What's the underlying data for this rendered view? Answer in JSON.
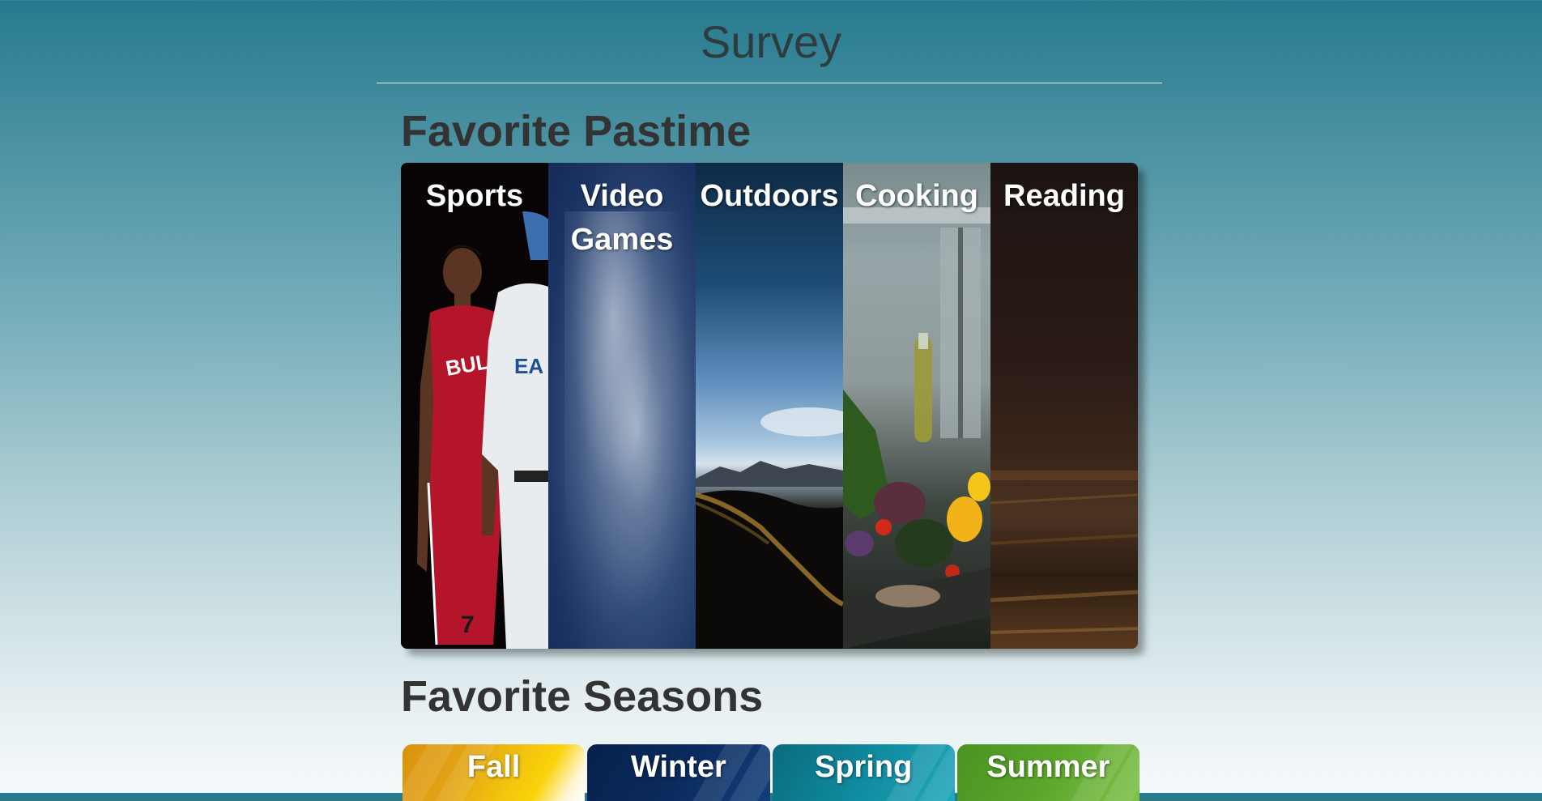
{
  "page": {
    "title": "Survey"
  },
  "pastime": {
    "heading": "Favorite Pastime",
    "options": [
      {
        "label": "Sports",
        "icon": "sports-photo"
      },
      {
        "label": "Video\nGames",
        "icon": "video-games-photo"
      },
      {
        "label": "Outdoors",
        "icon": "outdoors-photo"
      },
      {
        "label": "Cooking",
        "icon": "cooking-photo"
      },
      {
        "label": "Reading",
        "icon": "reading-photo"
      }
    ]
  },
  "seasons": {
    "heading": "Favorite Seasons",
    "options": [
      {
        "label": "Fall",
        "color": "#e3a516"
      },
      {
        "label": "Winter",
        "color": "#0a2a5c"
      },
      {
        "label": "Spring",
        "color": "#0f8a9e"
      },
      {
        "label": "Summer",
        "color": "#5aa62b"
      }
    ]
  },
  "colors": {
    "title_text": "#2f3b3f",
    "heading_text": "#333333",
    "background_top": "#267a8d",
    "background_bottom": "#f6f9fa"
  }
}
